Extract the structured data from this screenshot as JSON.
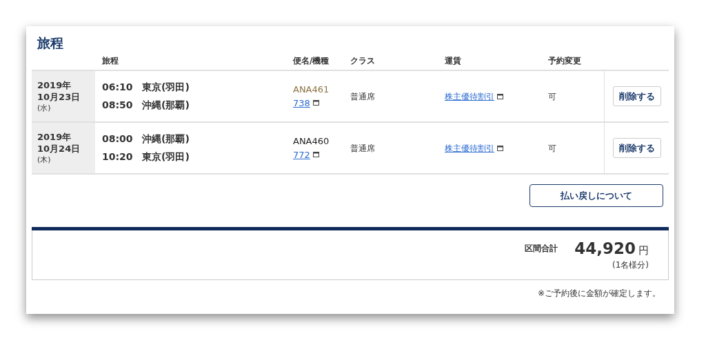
{
  "title": "旅程",
  "columns": [
    "旅程",
    "便名/機種",
    "クラス",
    "運賃",
    "予約変更"
  ],
  "rows": [
    {
      "date": "2019年",
      "month_day": "10月23日",
      "weekday": "(水)",
      "segments": [
        {
          "time": "06:10",
          "place": "東京(羽田)"
        },
        {
          "time": "08:50",
          "place": "沖縄(那覇)"
        }
      ],
      "flight": "ANA461",
      "color": "#8b7342",
      "aircraft": "738",
      "class": "普通席",
      "fare": "株主優待割引",
      "change": "可",
      "delete": "削除する"
    },
    {
      "date": "2019年",
      "month_day": "10月24日",
      "weekday": "(木)",
      "segments": [
        {
          "time": "08:00",
          "place": "沖縄(那覇)"
        },
        {
          "time": "10:20",
          "place": "東京(羽田)"
        }
      ],
      "flight": "ANA460",
      "color": "#222222",
      "aircraft": "772",
      "class": "普通席",
      "fare": "株主優待割引",
      "change": "可",
      "delete": "削除する"
    }
  ],
  "refund_button": "払い戻しについて",
  "total": {
    "label": "区間合計",
    "amount": "44,920",
    "unit": "円",
    "note": "(1名様分)"
  },
  "footnote": "※ご予約後に金額が確定します。"
}
